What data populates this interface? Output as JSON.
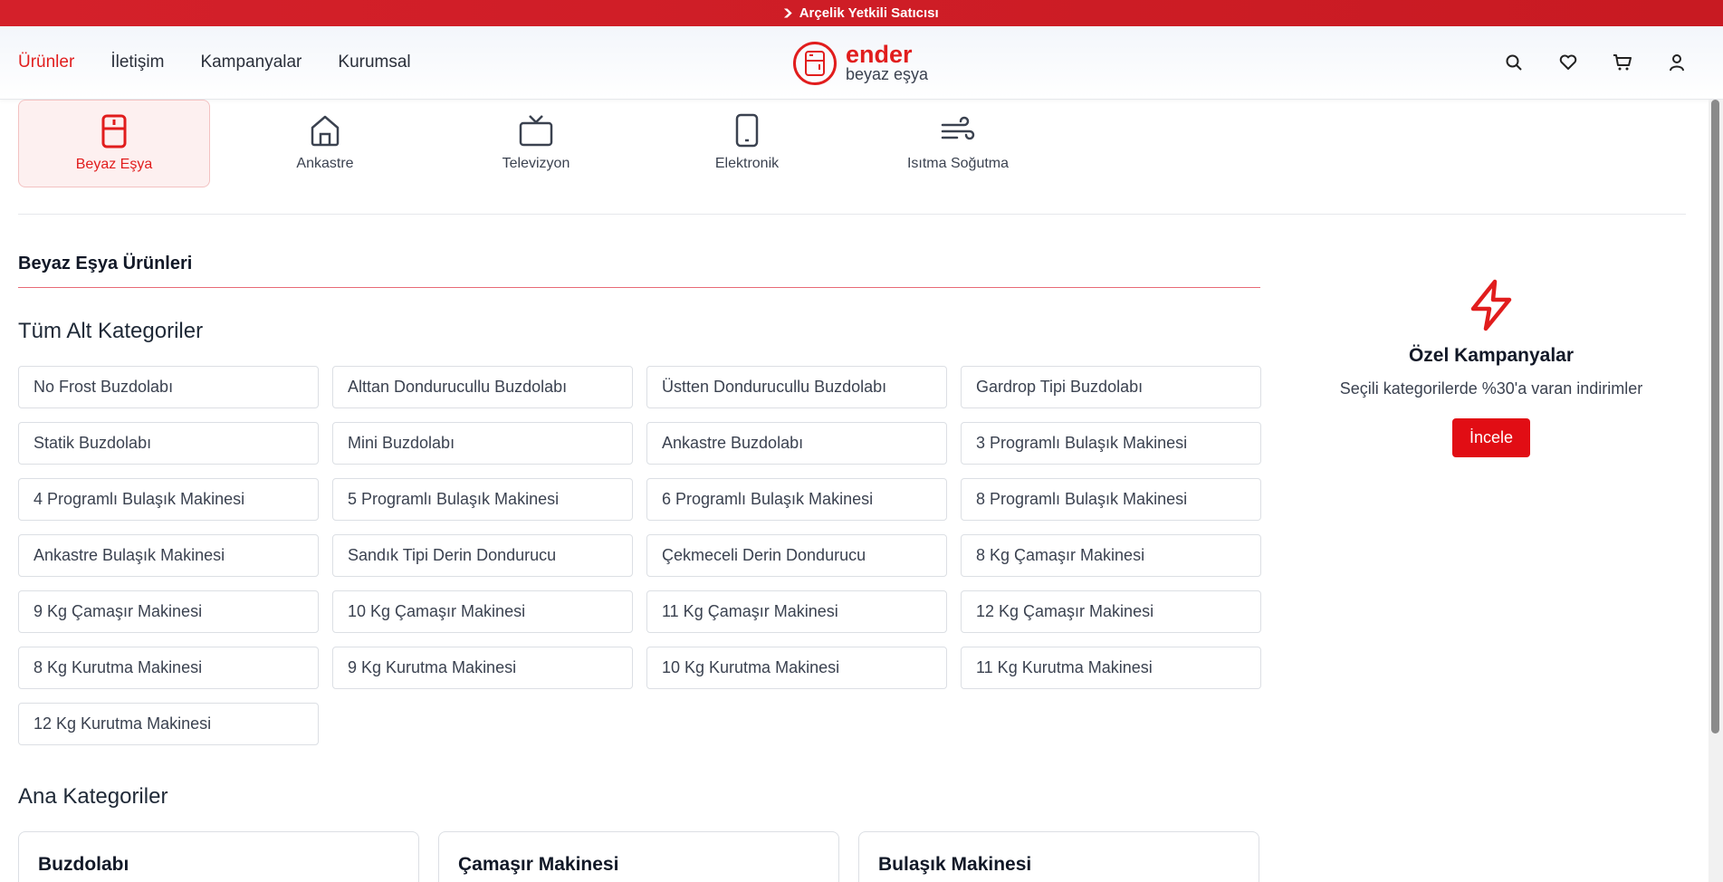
{
  "topbar": {
    "text": "Arçelik Yetkili Satıcısı"
  },
  "nav": {
    "items": [
      "Ürünler",
      "İletişim",
      "Kampanyalar",
      "Kurumsal"
    ]
  },
  "logo": {
    "brand": "ender",
    "sub": "beyaz eşya"
  },
  "categories": [
    {
      "label": "Beyaz Eşya",
      "icon": "fridge-icon"
    },
    {
      "label": "Ankastre",
      "icon": "home-icon"
    },
    {
      "label": "Televizyon",
      "icon": "tv-icon"
    },
    {
      "label": "Elektronik",
      "icon": "phone-icon"
    },
    {
      "label": "Isıtma Soğutma",
      "icon": "wind-icon"
    }
  ],
  "section": {
    "title": "Beyaz Eşya Ürünleri",
    "sub_title": "Tüm Alt Kategoriler",
    "main_title": "Ana Kategoriler"
  },
  "subcategories": [
    "No Frost Buzdolabı",
    "Alttan Dondurucullu Buzdolabı",
    "Üstten Dondurucullu Buzdolabı",
    "Gardrop Tipi Buzdolabı",
    "Statik Buzdolabı",
    "Mini Buzdolabı",
    "Ankastre Buzdolabı",
    "3 Programlı Bulaşık Makinesi",
    "4 Programlı Bulaşık Makinesi",
    "5 Programlı Bulaşık Makinesi",
    "6 Programlı Bulaşık Makinesi",
    "8 Programlı Bulaşık Makinesi",
    "Ankastre Bulaşık Makinesi",
    "Sandık Tipi Derin Dondurucu",
    "Çekmeceli Derin Dondurucu",
    "8 Kg Çamaşır Makinesi",
    "9 Kg Çamaşır Makinesi",
    "10 Kg Çamaşır Makinesi",
    "11 Kg Çamaşır Makinesi",
    "12 Kg Çamaşır Makinesi",
    "8 Kg Kurutma Makinesi",
    "9 Kg Kurutma Makinesi",
    "10 Kg Kurutma Makinesi",
    "11 Kg Kurutma Makinesi",
    "12 Kg Kurutma Makinesi"
  ],
  "main_categories": [
    "Buzdolabı",
    "Çamaşır Makinesi",
    "Bulaşık Makinesi"
  ],
  "campaign": {
    "title": "Özel Kampanyalar",
    "description": "Seçili kategorilerde %30'a varan indirimler",
    "button": "İncele"
  },
  "colors": {
    "accent": "#e11d1d",
    "topbar": "#d4202a"
  }
}
